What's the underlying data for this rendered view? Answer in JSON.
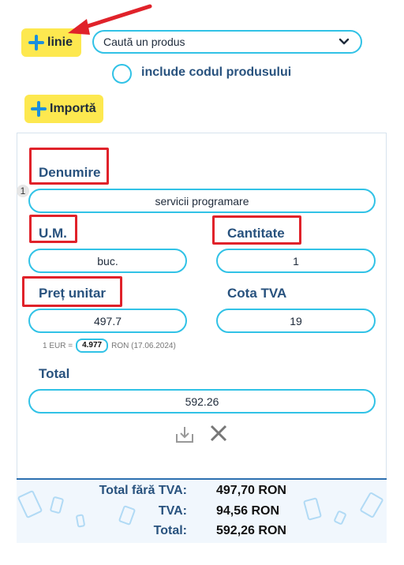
{
  "toolbar": {
    "add_line_label": "linie",
    "search_placeholder": "Caută un produs",
    "include_code_label": "include codul produsului",
    "import_label": "Importă"
  },
  "line": {
    "index": "1",
    "denumire_label": "Denumire",
    "denumire_value": "servicii programare",
    "um_label": "U.M.",
    "um_value": "buc.",
    "cantitate_label": "Cantitate",
    "cantitate_value": "1",
    "pret_label": "Preț unitar",
    "pret_value": "497.7",
    "cota_label": "Cota TVA",
    "cota_value": "19",
    "rate_prefix": "1 EUR =",
    "rate_value": "4.977",
    "rate_suffix": "RON (17.06.2024)",
    "total_label": "Total",
    "total_value": "592.26"
  },
  "totals": {
    "fara_tva_label": "Total fără TVA:",
    "fara_tva_value": "497,70 RON",
    "tva_label": "TVA:",
    "tva_value": "94,56 RON",
    "total_label": "Total:",
    "total_value": "592,26 RON"
  },
  "icons": {
    "save": "download-tray-icon",
    "delete": "close-x-icon",
    "add": "plus-icon"
  },
  "colors": {
    "accent_blue": "#31c2e6",
    "button_yellow": "#fde84f",
    "highlight_red": "#e0222a",
    "label_blue": "#28527e"
  }
}
